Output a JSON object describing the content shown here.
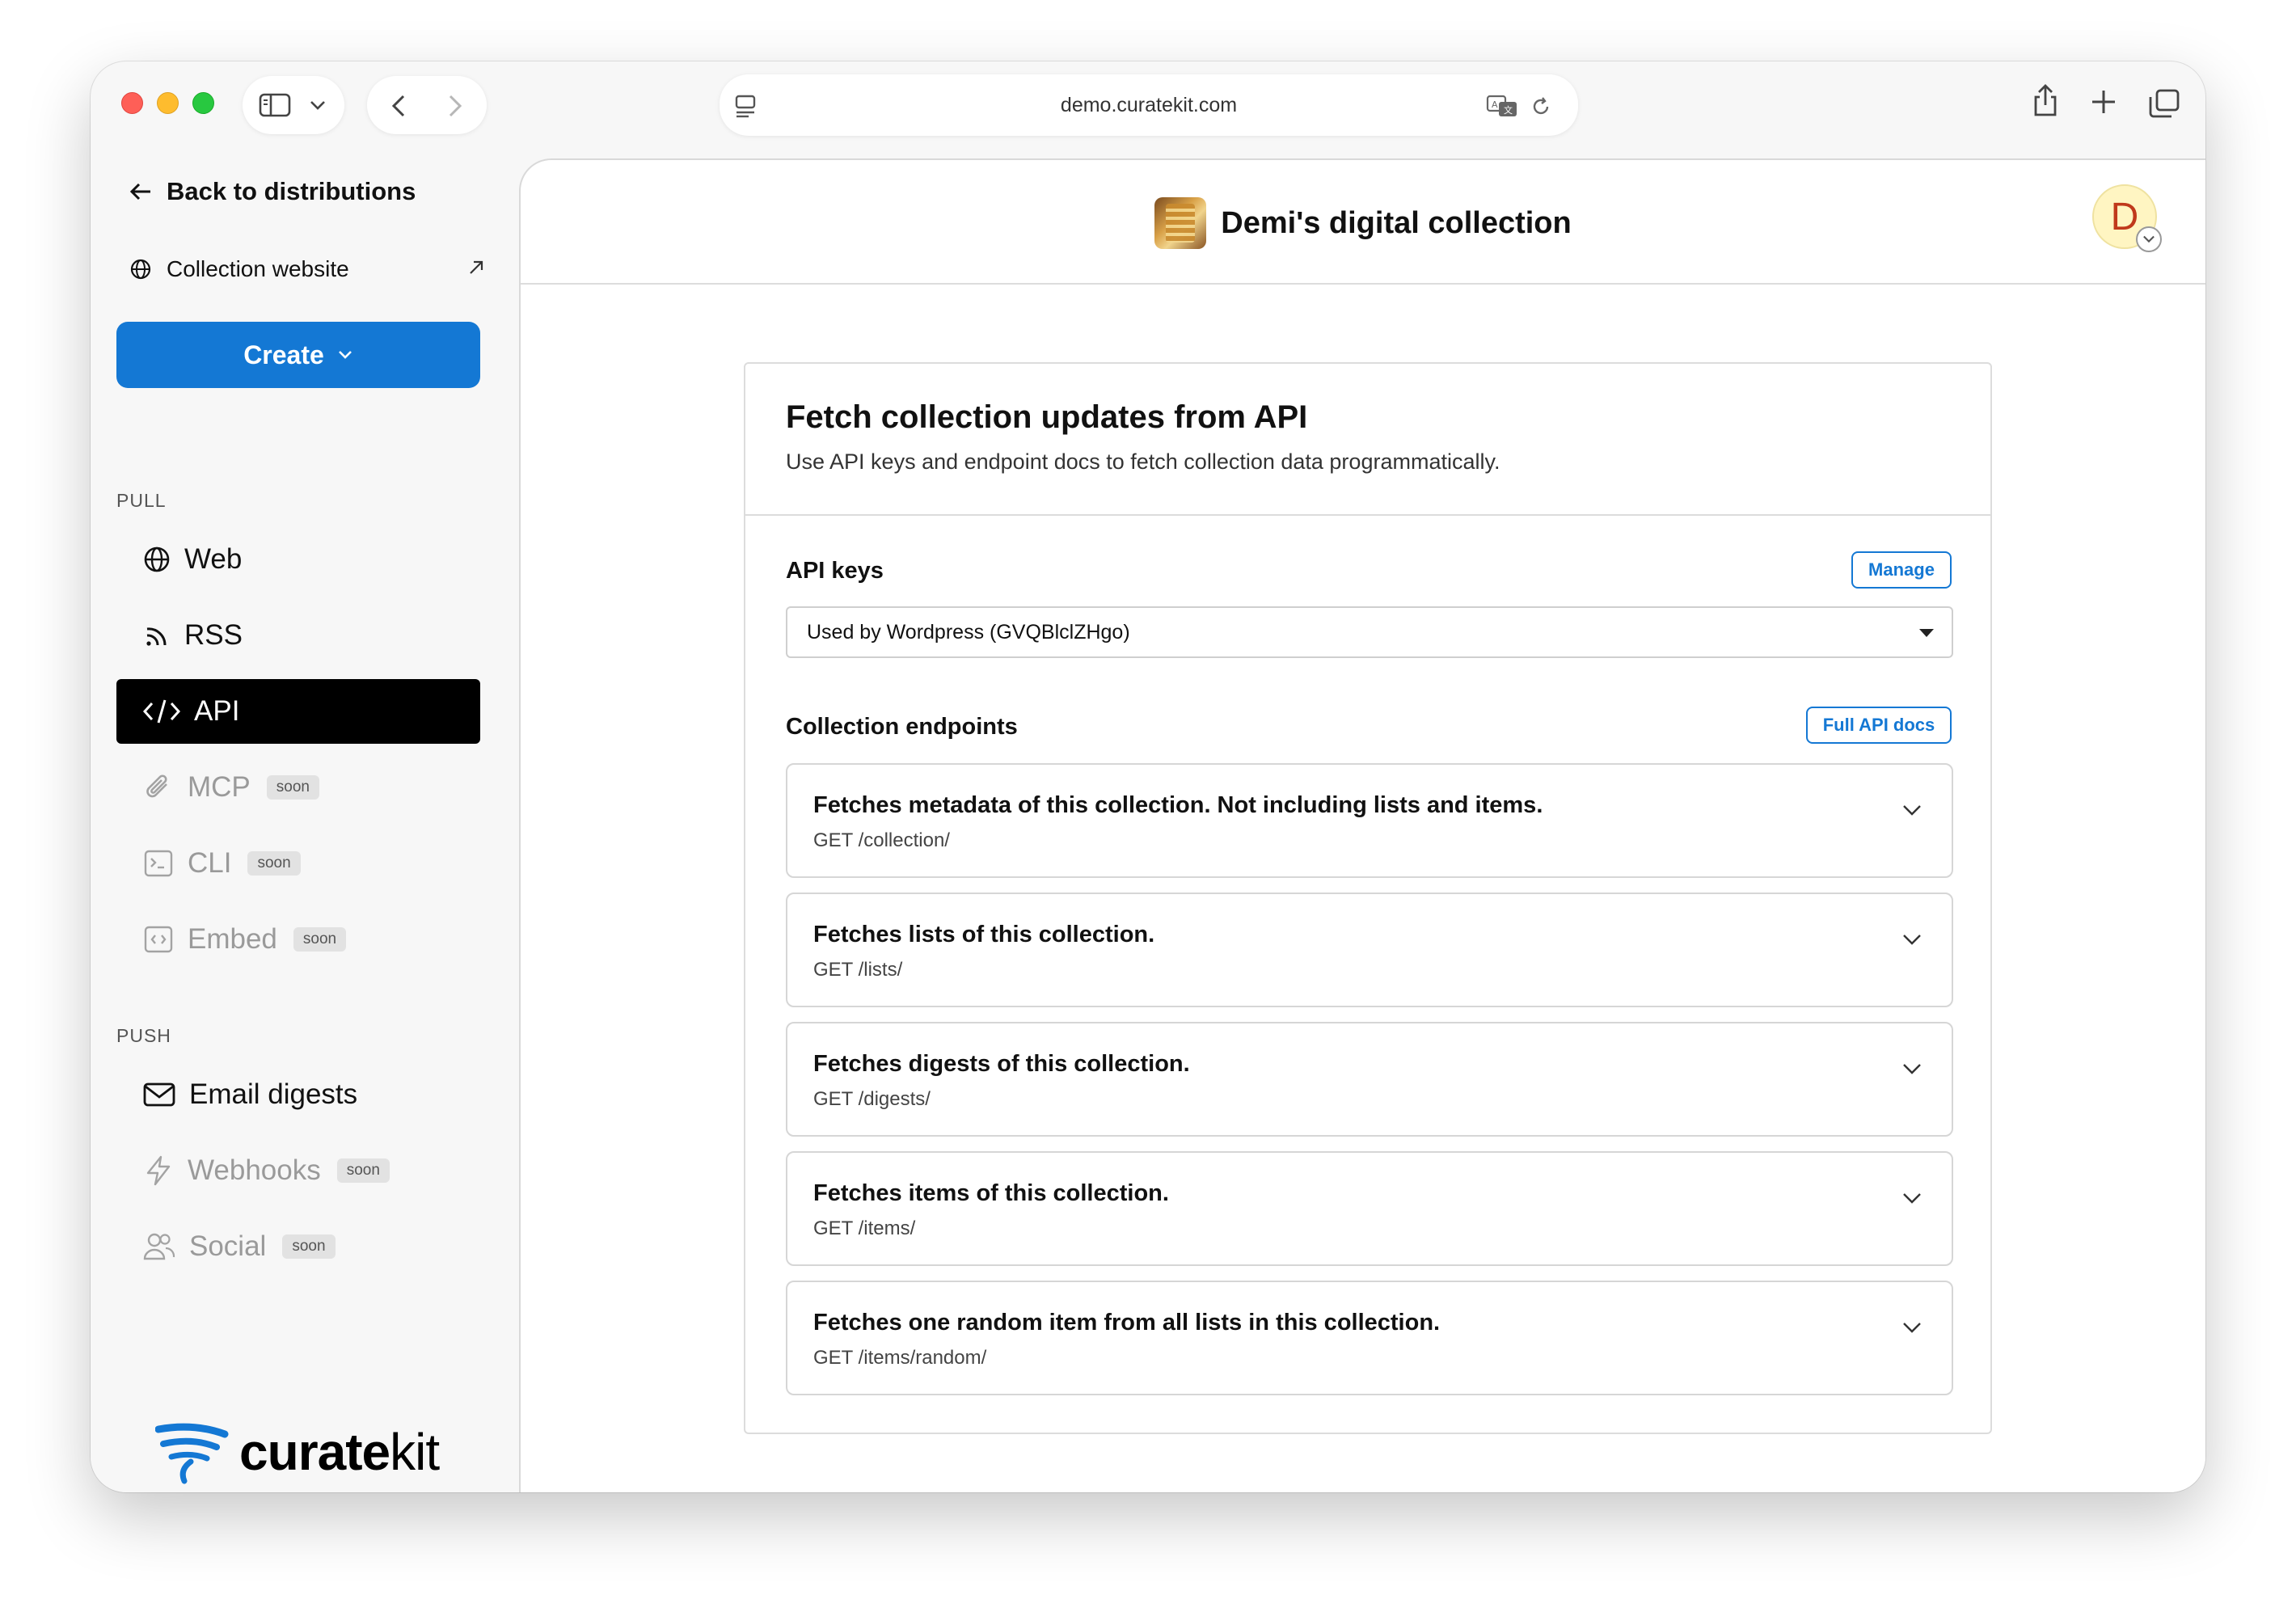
{
  "browser": {
    "url": "demo.curatekit.com"
  },
  "sidebar": {
    "back_label": "Back to distributions",
    "site_label": "Collection website",
    "create_label": "Create",
    "pull_heading": "PULL",
    "push_heading": "PUSH",
    "soon_label": "soon",
    "pull_items": [
      {
        "label": "Web",
        "icon": "globe-icon",
        "state": "normal"
      },
      {
        "label": "RSS",
        "icon": "rss-icon",
        "state": "normal"
      },
      {
        "label": "API",
        "icon": "code-icon",
        "state": "active"
      },
      {
        "label": "MCP",
        "icon": "paperclip-icon",
        "state": "soon"
      },
      {
        "label": "CLI",
        "icon": "terminal-icon",
        "state": "soon"
      },
      {
        "label": "Embed",
        "icon": "embed-icon",
        "state": "soon"
      }
    ],
    "push_items": [
      {
        "label": "Email digests",
        "icon": "mail-icon",
        "state": "normal"
      },
      {
        "label": "Webhooks",
        "icon": "bolt-icon",
        "state": "soon"
      },
      {
        "label": "Social",
        "icon": "users-icon",
        "state": "soon"
      }
    ],
    "logo": {
      "part1": "curate",
      "part2": "kit"
    }
  },
  "header": {
    "collection_name": "Demi's digital collection",
    "avatar_initial": "D"
  },
  "card": {
    "title": "Fetch collection updates from API",
    "description": "Use API keys and endpoint docs to fetch collection data programmatically.",
    "api_keys_label": "API keys",
    "manage_label": "Manage",
    "selected_key": "Used by Wordpress (GVQBlclZHgo)",
    "endpoints_label": "Collection endpoints",
    "docs_label": "Full API docs",
    "endpoints": [
      {
        "title": "Fetches metadata of this collection. Not including lists and items.",
        "path": "GET /collection/"
      },
      {
        "title": "Fetches lists of this collection.",
        "path": "GET /lists/"
      },
      {
        "title": "Fetches digests of this collection.",
        "path": "GET /digests/"
      },
      {
        "title": "Fetches items of this collection.",
        "path": "GET /items/"
      },
      {
        "title": "Fetches one random item from all lists in this collection.",
        "path": "GET /items/random/"
      }
    ]
  },
  "colors": {
    "accent": "#1478d4",
    "active_nav": "#000000"
  }
}
